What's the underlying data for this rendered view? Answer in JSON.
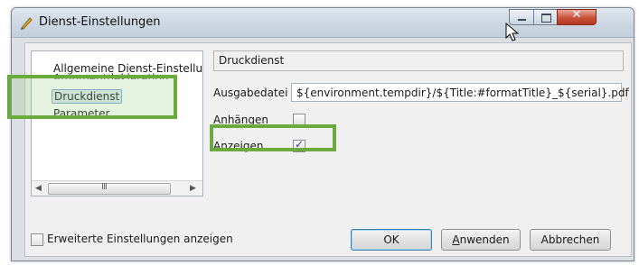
{
  "window": {
    "title": "Dienst-Einstellungen"
  },
  "tree": {
    "items": [
      {
        "label": "Allgemeine Dienst-Einstellun"
      },
      {
        "label": "Argumentdeklaration"
      },
      {
        "label": "Druckdienst",
        "selected": true
      },
      {
        "label": "Parameter"
      }
    ],
    "scroll_grip": "III"
  },
  "detail": {
    "name_value": "Druckdienst",
    "ausgabedatei_label": "Ausgabedatei",
    "ausgabedatei_value": "${environment.tempdir}/${Title:#formatTitle}_${serial}.pdf",
    "anhaengen_label": "Anhängen",
    "anhaengen_checked": false,
    "anzeigen_label": "Anzeigen",
    "anzeigen_checked": true
  },
  "footer": {
    "advanced_label": "Erweiterte Einstellungen anzeigen",
    "ok_label": "OK",
    "anwenden_mnemonic": "A",
    "anwenden_rest": "nwenden",
    "abbrechen_label": "Abbrechen"
  },
  "colors": {
    "highlight": "#6aaa3f",
    "accent": "#3c7fb1"
  },
  "icons": {
    "app": "pen-icon",
    "close": "close-icon",
    "minimize": "minimize-icon",
    "maximize": "maximize-icon",
    "cursor": "mouse-cursor-icon"
  }
}
